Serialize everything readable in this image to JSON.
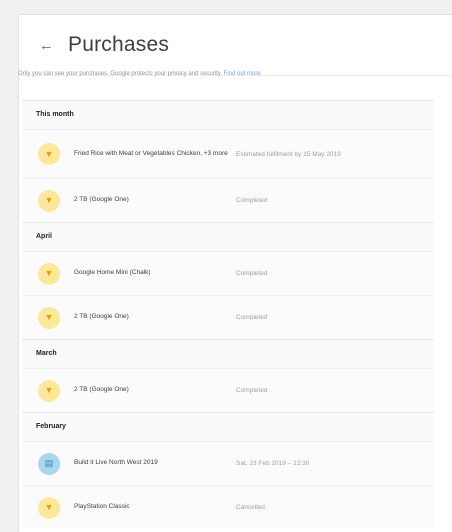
{
  "header": {
    "back_icon": "arrow-left-icon",
    "title": "Purchases"
  },
  "notice": {
    "text": "Only you can see your purchases. Google protects your privacy and security.",
    "link": "Find out more"
  },
  "sections": [
    {
      "month": "This month",
      "items": [
        {
          "title": "Fried Rice with Meat or Vegetables Chicken, +3 more",
          "status": "Estimated fulfilment by 15 May 2019",
          "icon": "receipt-icon",
          "color": "yellow"
        },
        {
          "title": "2 TB (Google One)",
          "status": "Completed",
          "icon": "receipt-icon",
          "color": "yellow"
        }
      ]
    },
    {
      "month": "April",
      "items": [
        {
          "title": "Google Home Mini (Chalk)",
          "status": "Completed",
          "icon": "receipt-icon",
          "color": "yellow"
        },
        {
          "title": "2 TB (Google One)",
          "status": "Completed",
          "icon": "receipt-icon",
          "color": "yellow"
        }
      ]
    },
    {
      "month": "March",
      "items": [
        {
          "title": "2 TB (Google One)",
          "status": "Completed",
          "icon": "receipt-icon",
          "color": "yellow"
        }
      ]
    },
    {
      "month": "February",
      "items": [
        {
          "title": "Build it Live North West 2019",
          "status": "Sat, 23 Feb 2019 – 12:30",
          "icon": "ticket-icon",
          "color": "blue"
        },
        {
          "title": "PlayStation Classic",
          "status": "Cancelled",
          "icon": "receipt-icon",
          "color": "yellow"
        }
      ]
    }
  ],
  "colors": {
    "icon_yellow": "#fbe89a",
    "icon_blue": "#a9d6f0",
    "link": "#7ea2db"
  }
}
